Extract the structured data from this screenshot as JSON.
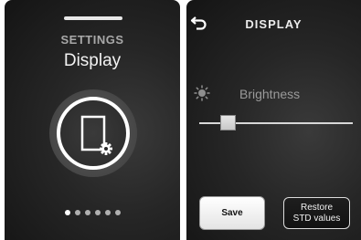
{
  "settings_screen": {
    "category": "SETTINGS",
    "title": "Display",
    "page_dots": {
      "count": 6,
      "active": 0
    },
    "icon": "display-settings-icon"
  },
  "display_screen": {
    "header": {
      "back_icon": "back-arrow-icon",
      "title": "DISPLAY"
    },
    "brightness": {
      "icon": "sun-icon",
      "label": "Brightness",
      "level": 0.19
    },
    "buttons": {
      "save_label": "Save",
      "restore_line1": "Restore",
      "restore_line2": "STD values"
    }
  },
  "colors": {
    "background": "#1a1a1a",
    "accent": "#ffffff",
    "label_muted": "#9a9a9a"
  }
}
